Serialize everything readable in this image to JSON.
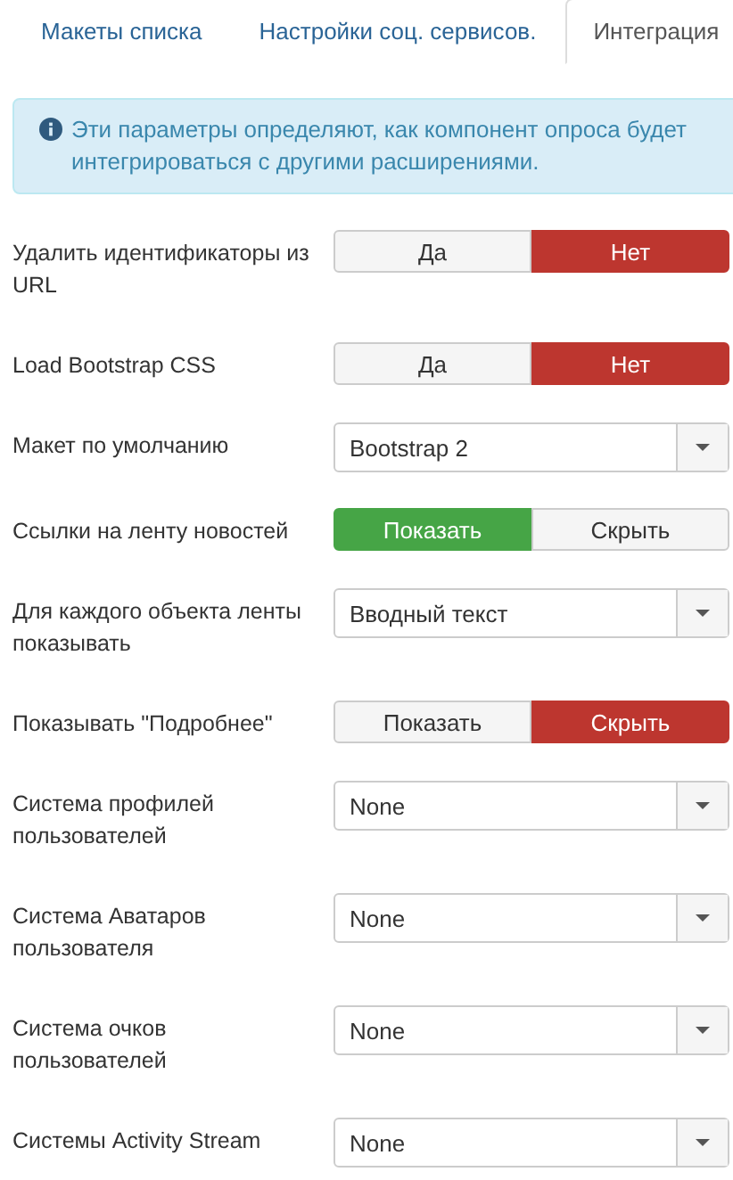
{
  "tabs": [
    {
      "label": "Макеты списка",
      "selected": false
    },
    {
      "label": "Настройки соц. сервисов.",
      "selected": false
    },
    {
      "label": "Интеграция",
      "selected": true
    }
  ],
  "alert": {
    "text": "Эти параметры определяют, как компонент опроса будет интегрироваться с другими расширениями."
  },
  "fields": [
    {
      "kind": "toggle",
      "label": "Удалить идентификаторы из URL",
      "options": [
        {
          "label": "Да",
          "selected": false
        },
        {
          "label": "Нет",
          "selected": true
        }
      ]
    },
    {
      "kind": "toggle",
      "label": "Load Bootstrap CSS",
      "options": [
        {
          "label": "Да",
          "selected": false
        },
        {
          "label": "Нет",
          "selected": true
        }
      ]
    },
    {
      "kind": "select",
      "label": "Макет по умолчанию",
      "value": "Bootstrap 2"
    },
    {
      "kind": "toggle",
      "label": "Ссылки на ленту новостей",
      "options": [
        {
          "label": "Показать",
          "selected": true
        },
        {
          "label": "Скрыть",
          "selected": false
        }
      ]
    },
    {
      "kind": "select",
      "label": "Для каждого объекта ленты показывать",
      "value": "Вводный текст"
    },
    {
      "kind": "toggle",
      "label": "Показывать \"Подробнее\"",
      "options": [
        {
          "label": "Показать",
          "selected": false
        },
        {
          "label": "Скрыть",
          "selected": true
        }
      ]
    },
    {
      "kind": "select",
      "label": "Система профилей пользователей",
      "value": "None"
    },
    {
      "kind": "select",
      "label": "Система Аватаров пользователя",
      "value": "None"
    },
    {
      "kind": "select",
      "label": "Система очков пользователей",
      "value": "None"
    },
    {
      "kind": "select",
      "label": "Системы Activity Stream",
      "value": "None"
    }
  ]
}
